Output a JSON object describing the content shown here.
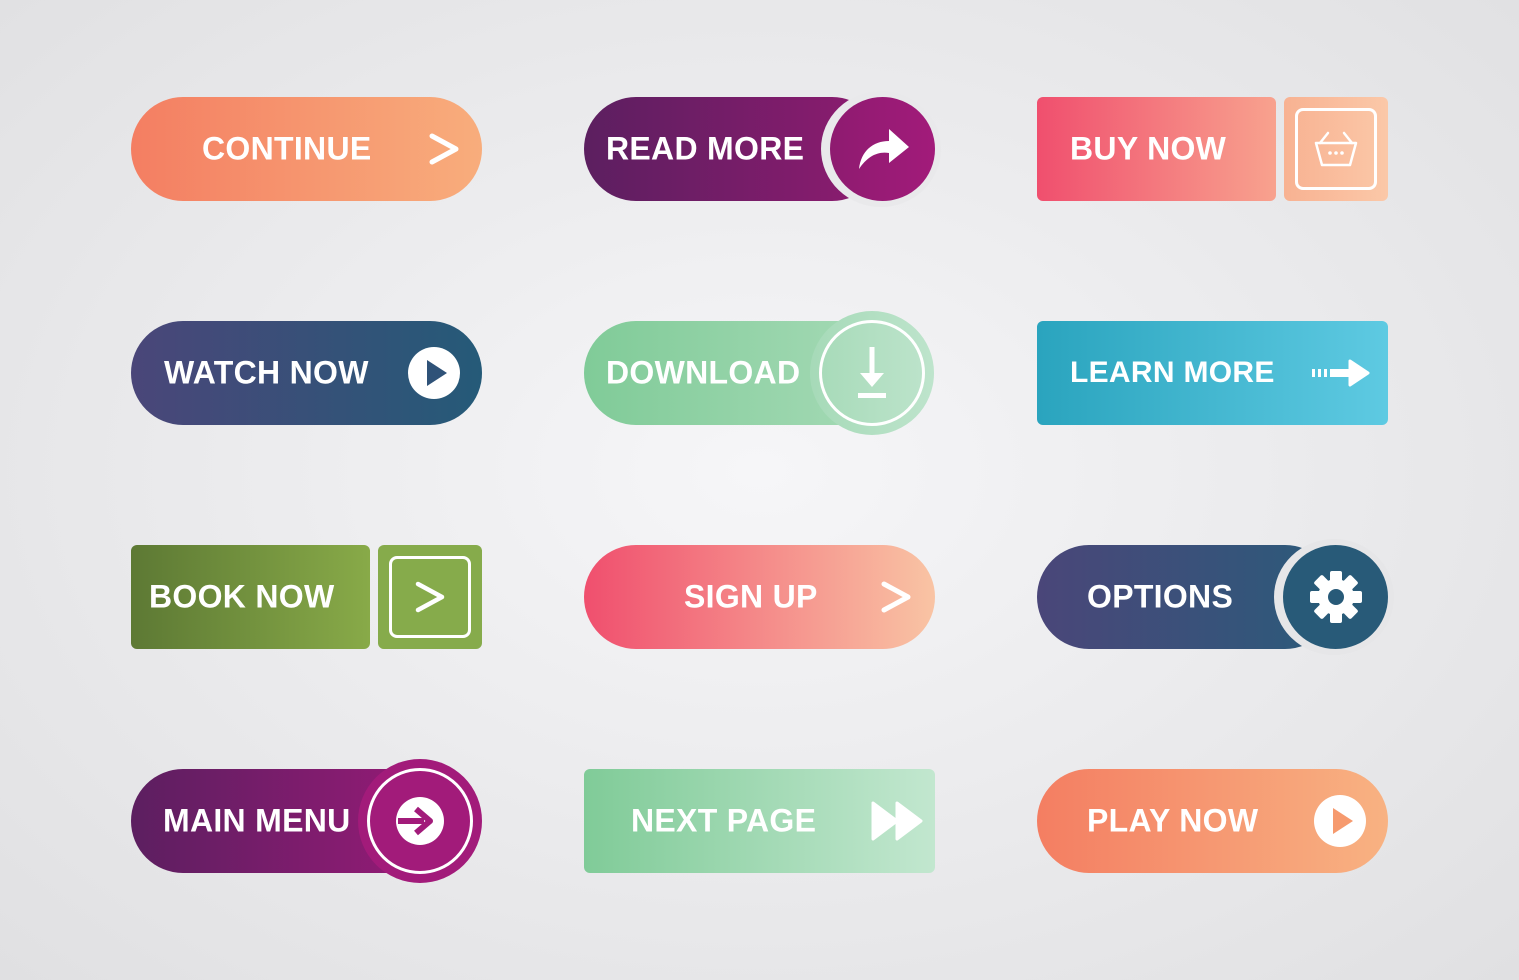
{
  "buttons": {
    "continue": {
      "label": "CONTINUE",
      "icon": "chevron-right-icon",
      "colors": [
        "#f47e62",
        "#f8ad7c"
      ]
    },
    "read_more": {
      "label": "READ MORE",
      "icon": "share-arrow-icon",
      "colors": [
        "#5c1f60",
        "#8e1b70",
        "#a21b7a"
      ]
    },
    "buy_now": {
      "label": "BUY NOW",
      "icon": "basket-icon",
      "colors": [
        "#f04f6e",
        "#f8a28e",
        "#f8b292",
        "#fbc8a8"
      ]
    },
    "watch_now": {
      "label": "WATCH NOW",
      "icon": "play-circle-icon",
      "colors": [
        "#4a4679",
        "#255a78"
      ]
    },
    "download": {
      "label": "DOWNLOAD",
      "icon": "download-icon",
      "colors": [
        "#80cb98",
        "#b6e1c5"
      ]
    },
    "learn_more": {
      "label": "LEARN MORE",
      "icon": "dashed-arrow-right-icon",
      "colors": [
        "#2aa4be",
        "#5ecae2"
      ]
    },
    "book_now": {
      "label": "BOOK NOW",
      "icon": "chevron-right-icon",
      "colors": [
        "#5d7934",
        "#88aa48"
      ]
    },
    "sign_up": {
      "label": "SIGN UP",
      "icon": "chevron-right-icon",
      "colors": [
        "#f04f6e",
        "#f9c4a4"
      ]
    },
    "options": {
      "label": "OPTIONS",
      "icon": "gear-icon",
      "colors": [
        "#4a4679",
        "#2b5b7a",
        "#285a78"
      ]
    },
    "main_menu": {
      "label": "MAIN MENU",
      "icon": "arrow-in-circle-icon",
      "colors": [
        "#5c1f60",
        "#9a1a78",
        "#a21b7a"
      ]
    },
    "next_page": {
      "label": "NEXT PAGE",
      "icon": "fast-forward-icon",
      "colors": [
        "#80cb98",
        "#c2e7cf"
      ]
    },
    "play_now": {
      "label": "PLAY NOW",
      "icon": "play-circle-icon",
      "colors": [
        "#f47e62",
        "#f8b282"
      ]
    }
  }
}
